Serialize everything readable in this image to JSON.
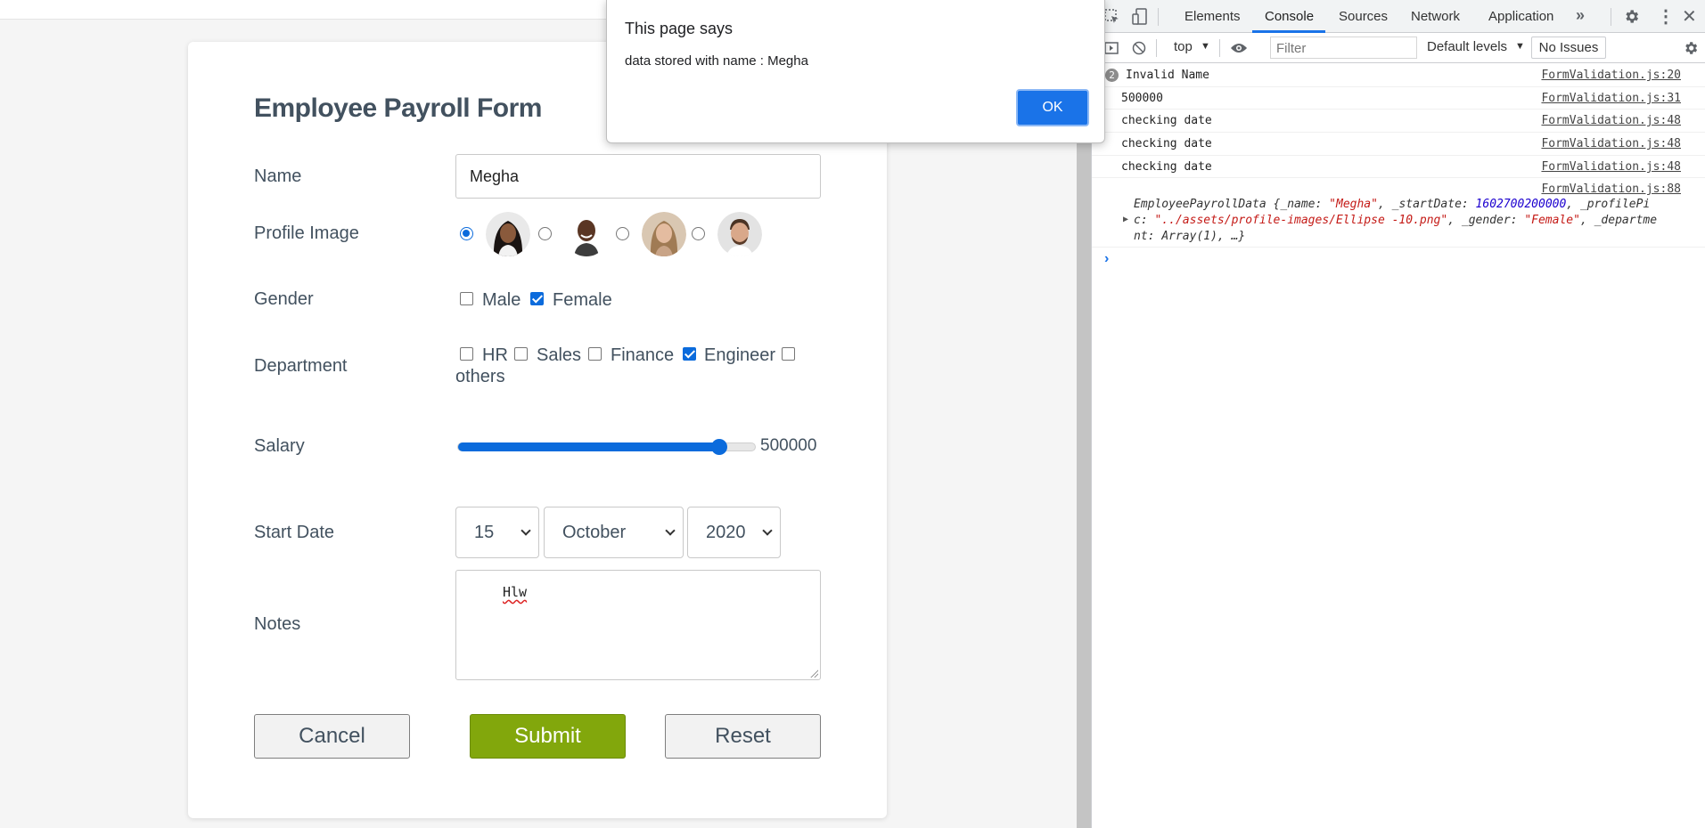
{
  "dialog": {
    "title": "This page says",
    "message": "data stored with name : Megha",
    "ok_label": "OK"
  },
  "form": {
    "title": "Employee Payroll Form",
    "labels": {
      "name": "Name",
      "profile_image": "Profile Image",
      "gender": "Gender",
      "department": "Department",
      "salary": "Salary",
      "start_date": "Start Date",
      "notes": "Notes"
    },
    "name_value": "Megha",
    "profile_images": [
      {
        "name": "avatar-woman-dark-hair",
        "selected": true
      },
      {
        "name": "avatar-man-bald",
        "selected": false
      },
      {
        "name": "avatar-woman-light-hair",
        "selected": false
      },
      {
        "name": "avatar-man-beard",
        "selected": false
      }
    ],
    "gender": [
      {
        "label": "Male",
        "checked": false
      },
      {
        "label": "Female",
        "checked": true
      }
    ],
    "departments": [
      {
        "label": "HR",
        "checked": false
      },
      {
        "label": "Sales",
        "checked": false
      },
      {
        "label": "Finance",
        "checked": false
      },
      {
        "label": "Engineer",
        "checked": true
      },
      {
        "label": "others",
        "checked": false
      }
    ],
    "salary": {
      "value_text": "500000",
      "fill_fraction": 0.88
    },
    "start_date": {
      "day": "15",
      "month": "October",
      "year": "2020"
    },
    "notes_value": "Hlw",
    "buttons": {
      "cancel": "Cancel",
      "submit": "Submit",
      "reset": "Reset"
    },
    "colors": {
      "text": "#42515f",
      "submit": "#82a70c",
      "accent": "#0b6bdc"
    }
  },
  "devtools": {
    "tabs": [
      "Elements",
      "Console",
      "Sources",
      "Network",
      "Application"
    ],
    "active_tab": "Console",
    "toolbar": {
      "context": "top",
      "filter_placeholder": "Filter",
      "levels": "Default levels",
      "issues": "No Issues"
    },
    "console": [
      {
        "count": "2",
        "message": "Invalid Name",
        "source": "FormValidation.js:20"
      },
      {
        "message": "500000",
        "source": "FormValidation.js:31"
      },
      {
        "message": "checking date",
        "source": "FormValidation.js:48"
      },
      {
        "message": "checking date",
        "source": "FormValidation.js:48"
      },
      {
        "message": "checking date",
        "source": "FormValidation.js:48"
      },
      {
        "message": "",
        "source": "FormValidation.js:88"
      }
    ],
    "object_log": {
      "class_name": "EmployeePayrollData",
      "k_name": "_name:",
      "v_name": "\"Megha\"",
      "k_start": "_startDate:",
      "v_start": "1602700200000",
      "k_pic_a": "_profilePi",
      "k_pic_b": "c:",
      "v_pic": "\"../assets/profile-images/Ellipse -10.png\"",
      "k_gender": "_gender:",
      "v_gender": "\"Female\"",
      "k_dept_a": "_departme",
      "k_dept_b": "nt:",
      "v_dept": "Array(1), …}"
    }
  }
}
